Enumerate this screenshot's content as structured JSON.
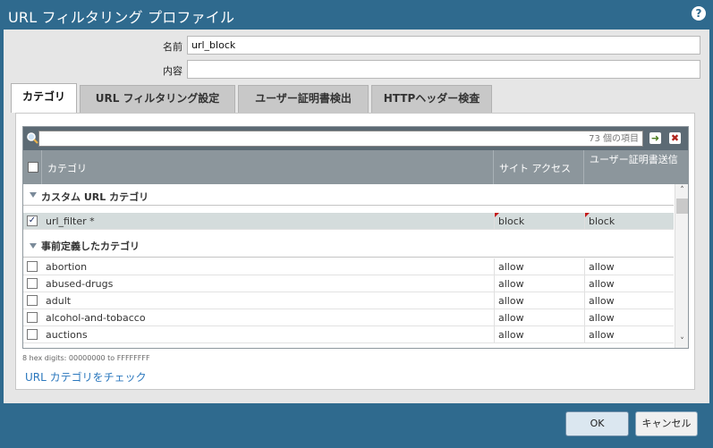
{
  "window": {
    "title": "URL フィルタリング プロファイル",
    "help_icon": "?"
  },
  "form": {
    "name_label": "名前",
    "name_value": "url_block",
    "desc_label": "内容",
    "desc_value": ""
  },
  "tabs": [
    {
      "label": "カテゴリ",
      "active": true
    },
    {
      "label": "URL フィルタリング設定",
      "active": false
    },
    {
      "label": "ユーザー証明書検出",
      "active": false
    },
    {
      "label": "HTTPヘッダー検査",
      "active": false
    }
  ],
  "grid": {
    "search_placeholder": "73 個の項目",
    "go_glyph": "➜",
    "clear_glyph": "✖",
    "columns": [
      "カテゴリ",
      "サイト アクセス",
      "ユーザー証明書送信"
    ],
    "groups": [
      {
        "label": "カスタム URL カテゴリ"
      },
      {
        "label": "事前定義したカテゴリ"
      }
    ],
    "custom_rows": [
      {
        "name": "url_filter *",
        "site_access": "block",
        "cred": "block",
        "checked": true
      }
    ],
    "predefined_rows": [
      {
        "name": "abortion",
        "site_access": "allow",
        "cred": "allow",
        "checked": false
      },
      {
        "name": "abused-drugs",
        "site_access": "allow",
        "cred": "allow",
        "checked": false
      },
      {
        "name": "adult",
        "site_access": "allow",
        "cred": "allow",
        "checked": false
      },
      {
        "name": "alcohol-and-tobacco",
        "site_access": "allow",
        "cred": "allow",
        "checked": false
      },
      {
        "name": "auctions",
        "site_access": "allow",
        "cred": "allow",
        "checked": false
      }
    ],
    "scroll_up": "˄",
    "scroll_down": "˅"
  },
  "hint": "8 hex digits: 00000000 to FFFFFFFF",
  "check_link": "URL カテゴリをチェック",
  "buttons": {
    "ok": "OK",
    "cancel": "キャンセル"
  },
  "colors": {
    "title_bar": "#2f6a8e",
    "grid_header": "#8c969c",
    "link": "#2a77bd",
    "flag": "#c41a1a"
  }
}
